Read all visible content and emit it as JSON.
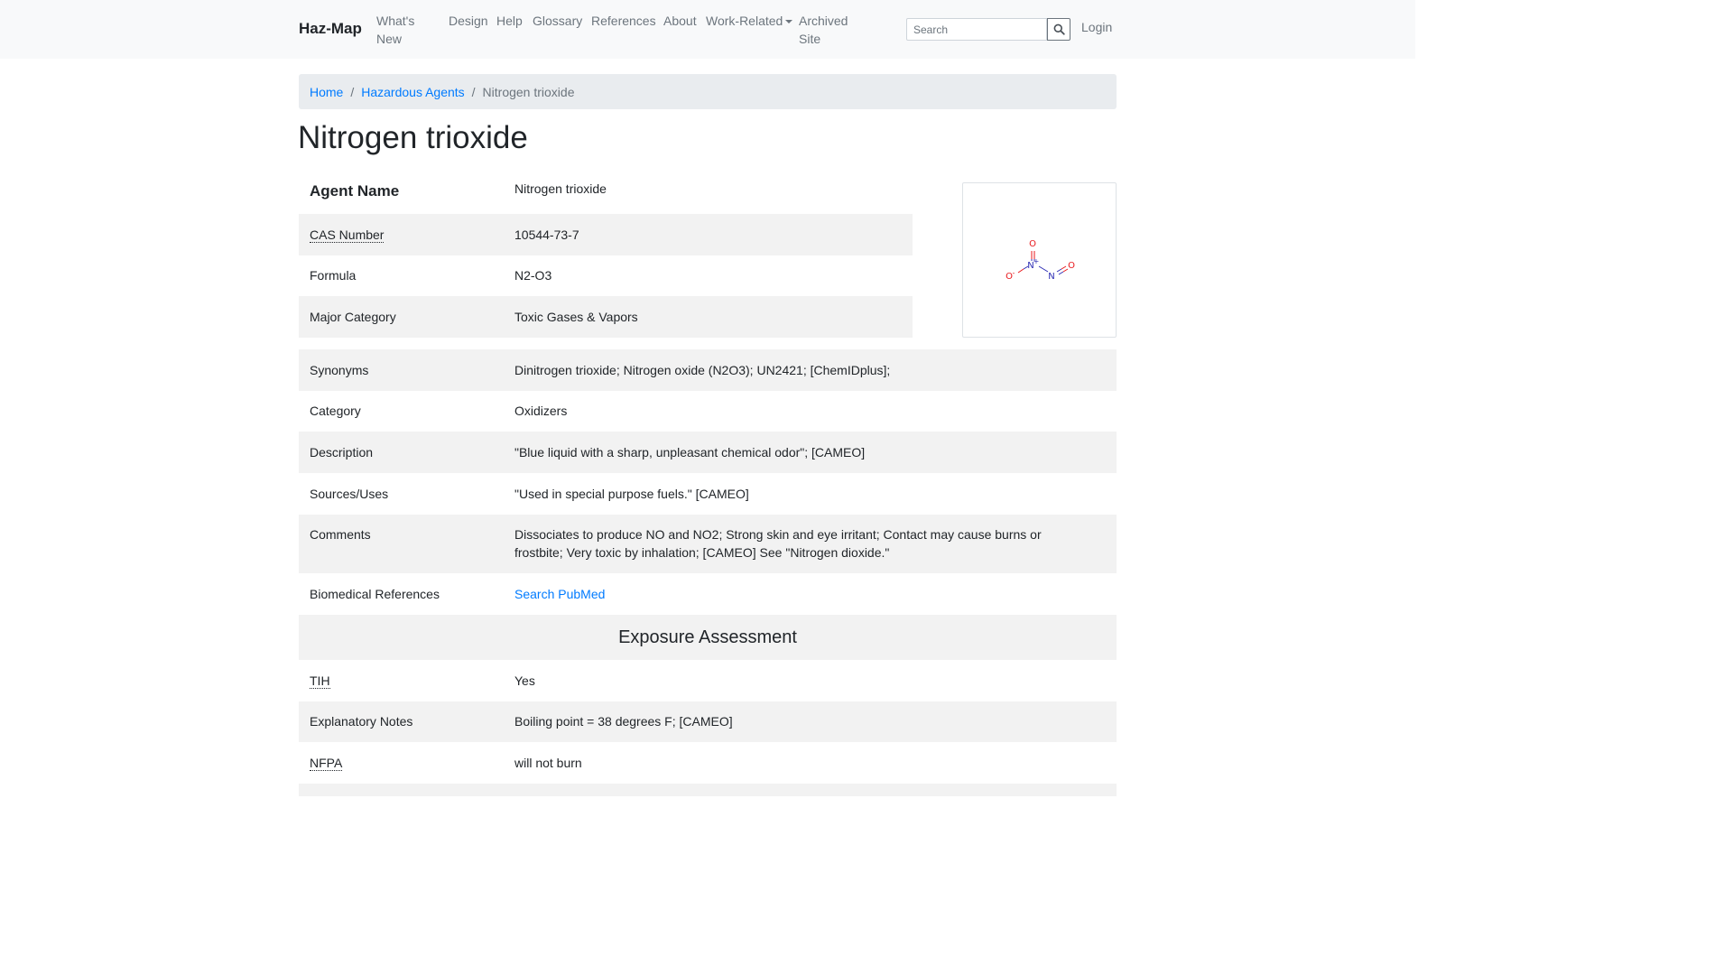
{
  "nav": {
    "brand": "Haz-Map",
    "items": [
      {
        "label": "What's New"
      },
      {
        "label": "Design"
      },
      {
        "label": "Help"
      },
      {
        "label": "Glossary"
      },
      {
        "label": "References"
      },
      {
        "label": "About"
      },
      {
        "label": "Work-Related"
      },
      {
        "label": "Archived Site"
      }
    ],
    "search_placeholder": "Search",
    "search_icon": "magnifier-icon",
    "login": "Login"
  },
  "breadcrumb": {
    "home": "Home",
    "section": "Hazardous Agents",
    "current": "Nitrogen trioxide"
  },
  "page_title": "Nitrogen trioxide",
  "agent": {
    "agent_name_label": "Agent Name",
    "agent_name": "Nitrogen trioxide",
    "rows": [
      {
        "label": "CAS Number",
        "value": "10544-73-7"
      },
      {
        "label": "Formula",
        "value": "N2-O3"
      },
      {
        "label": "Major Category",
        "value": "Toxic Gases & Vapors"
      },
      {
        "label": "Synonyms",
        "value": "Dinitrogen trioxide; Nitrogen oxide (N2O3); UN2421; [ChemIDplus];"
      },
      {
        "label": "Category",
        "value": "Oxidizers"
      },
      {
        "label": "Description",
        "value": "\"Blue liquid with a sharp, unpleasant chemical odor\"; [CAMEO]"
      },
      {
        "label": "Sources/Uses",
        "value": "\"Used in special purpose fuels.\" [CAMEO]"
      },
      {
        "label": "Comments",
        "value": "Dissociates to produce NO and NO2; Strong skin and eye irritant; Contact may cause burns or frostbite; Very toxic by inhalation; [CAMEO] See \"Nitrogen dioxide.\""
      },
      {
        "label": "Biomedical References",
        "value": "Search PubMed"
      }
    ]
  },
  "structure": {
    "atoms": {
      "o_top": "O",
      "n_plus": "N",
      "plus": "+",
      "o_minus": "O",
      "minus": "-",
      "n": "N",
      "o_right": "O"
    },
    "atom_colors": {
      "oxygen": "#e8171b",
      "nitrogen": "#2c2cb4"
    }
  },
  "exposure": {
    "header": "Exposure Assessment",
    "rows": [
      {
        "label": "TIH",
        "value": "Yes"
      },
      {
        "label": "Explanatory Notes",
        "value": "Boiling point = 38 degrees F; [CAMEO]"
      },
      {
        "label": "NFPA",
        "value": "will not burn"
      }
    ]
  },
  "colors": {
    "link": "#007bff",
    "navbar_bg": "#f8f9fa",
    "stripe": "#f2f2f2",
    "breadcrumb_bg": "#e9ecef"
  }
}
